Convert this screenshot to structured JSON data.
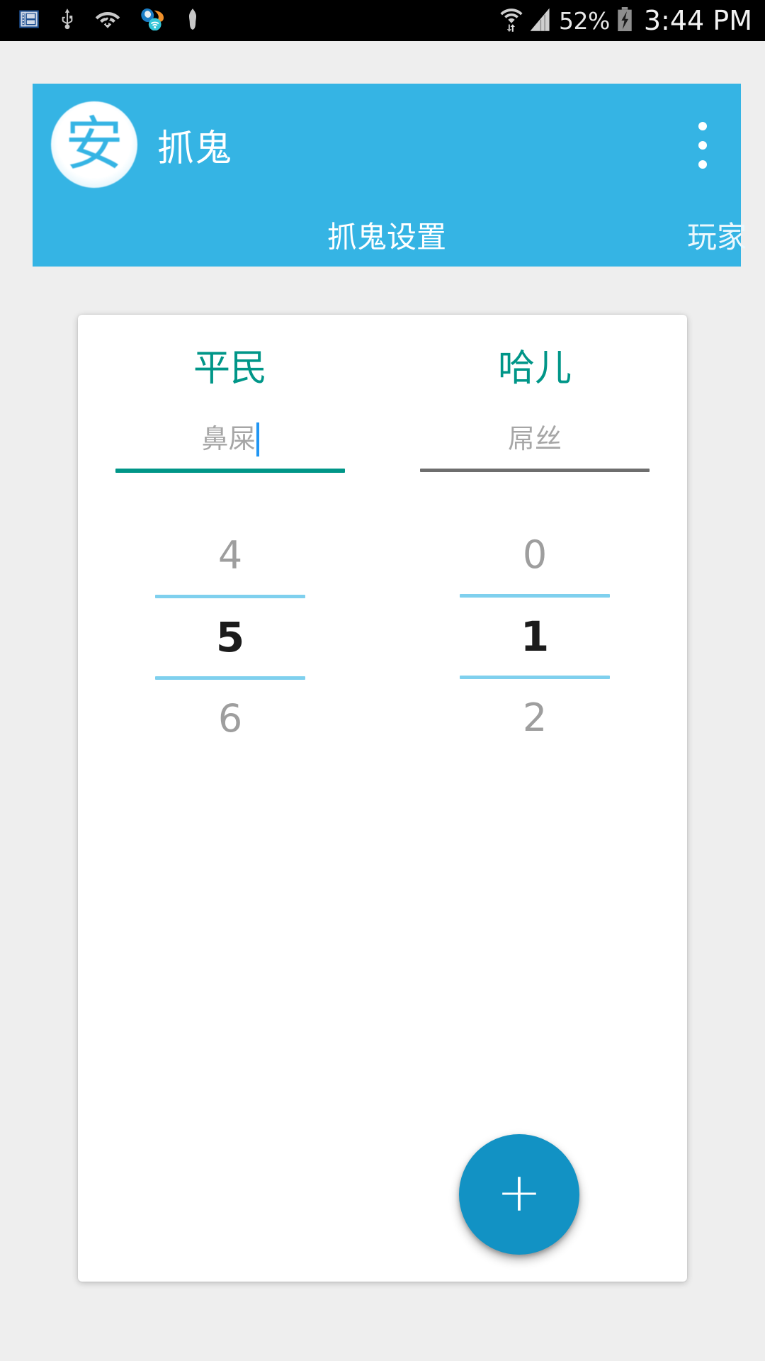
{
  "status_bar": {
    "icons_left": [
      "gallery-icon",
      "usb-icon",
      "wifi-unknown-icon",
      "sogou-input-icon",
      "bomb-icon"
    ],
    "icons_right": [
      "wifi-signal-icon",
      "cellular-signal-icon",
      "battery-charging-icon"
    ],
    "battery_percent": "52%",
    "clock": "3:44 PM",
    "background_color": "#000000"
  },
  "app_bar": {
    "logo_glyph": "安",
    "logo_icon_name": "app-logo-icon",
    "title": "抓鬼",
    "overflow_icon_name": "overflow-menu-icon",
    "background_color": "#35B4E4",
    "tabs": [
      {
        "label": "抓鬼设置",
        "selected": true
      },
      {
        "label": "玩家",
        "selected": false
      }
    ]
  },
  "card": {
    "accent_color": "#009688",
    "picker_divider_color": "#7FD0EE",
    "columns": [
      {
        "role_title": "平民",
        "field": {
          "value": "鼻屎",
          "placeholder": "鼻屎",
          "focused": true,
          "caret_visible": true,
          "underline_color": "#009688"
        },
        "picker": {
          "prev": "4",
          "selected": "5",
          "next": "6"
        }
      },
      {
        "role_title": "哈儿",
        "field": {
          "value": "屌丝",
          "placeholder": "屌丝",
          "focused": false,
          "caret_visible": false,
          "underline_color": "#6E6E6E"
        },
        "picker": {
          "prev": "0",
          "selected": "1",
          "next": "2"
        }
      }
    ],
    "fab": {
      "label": "+",
      "icon_name": "add-icon",
      "color": "#1292C4"
    }
  }
}
